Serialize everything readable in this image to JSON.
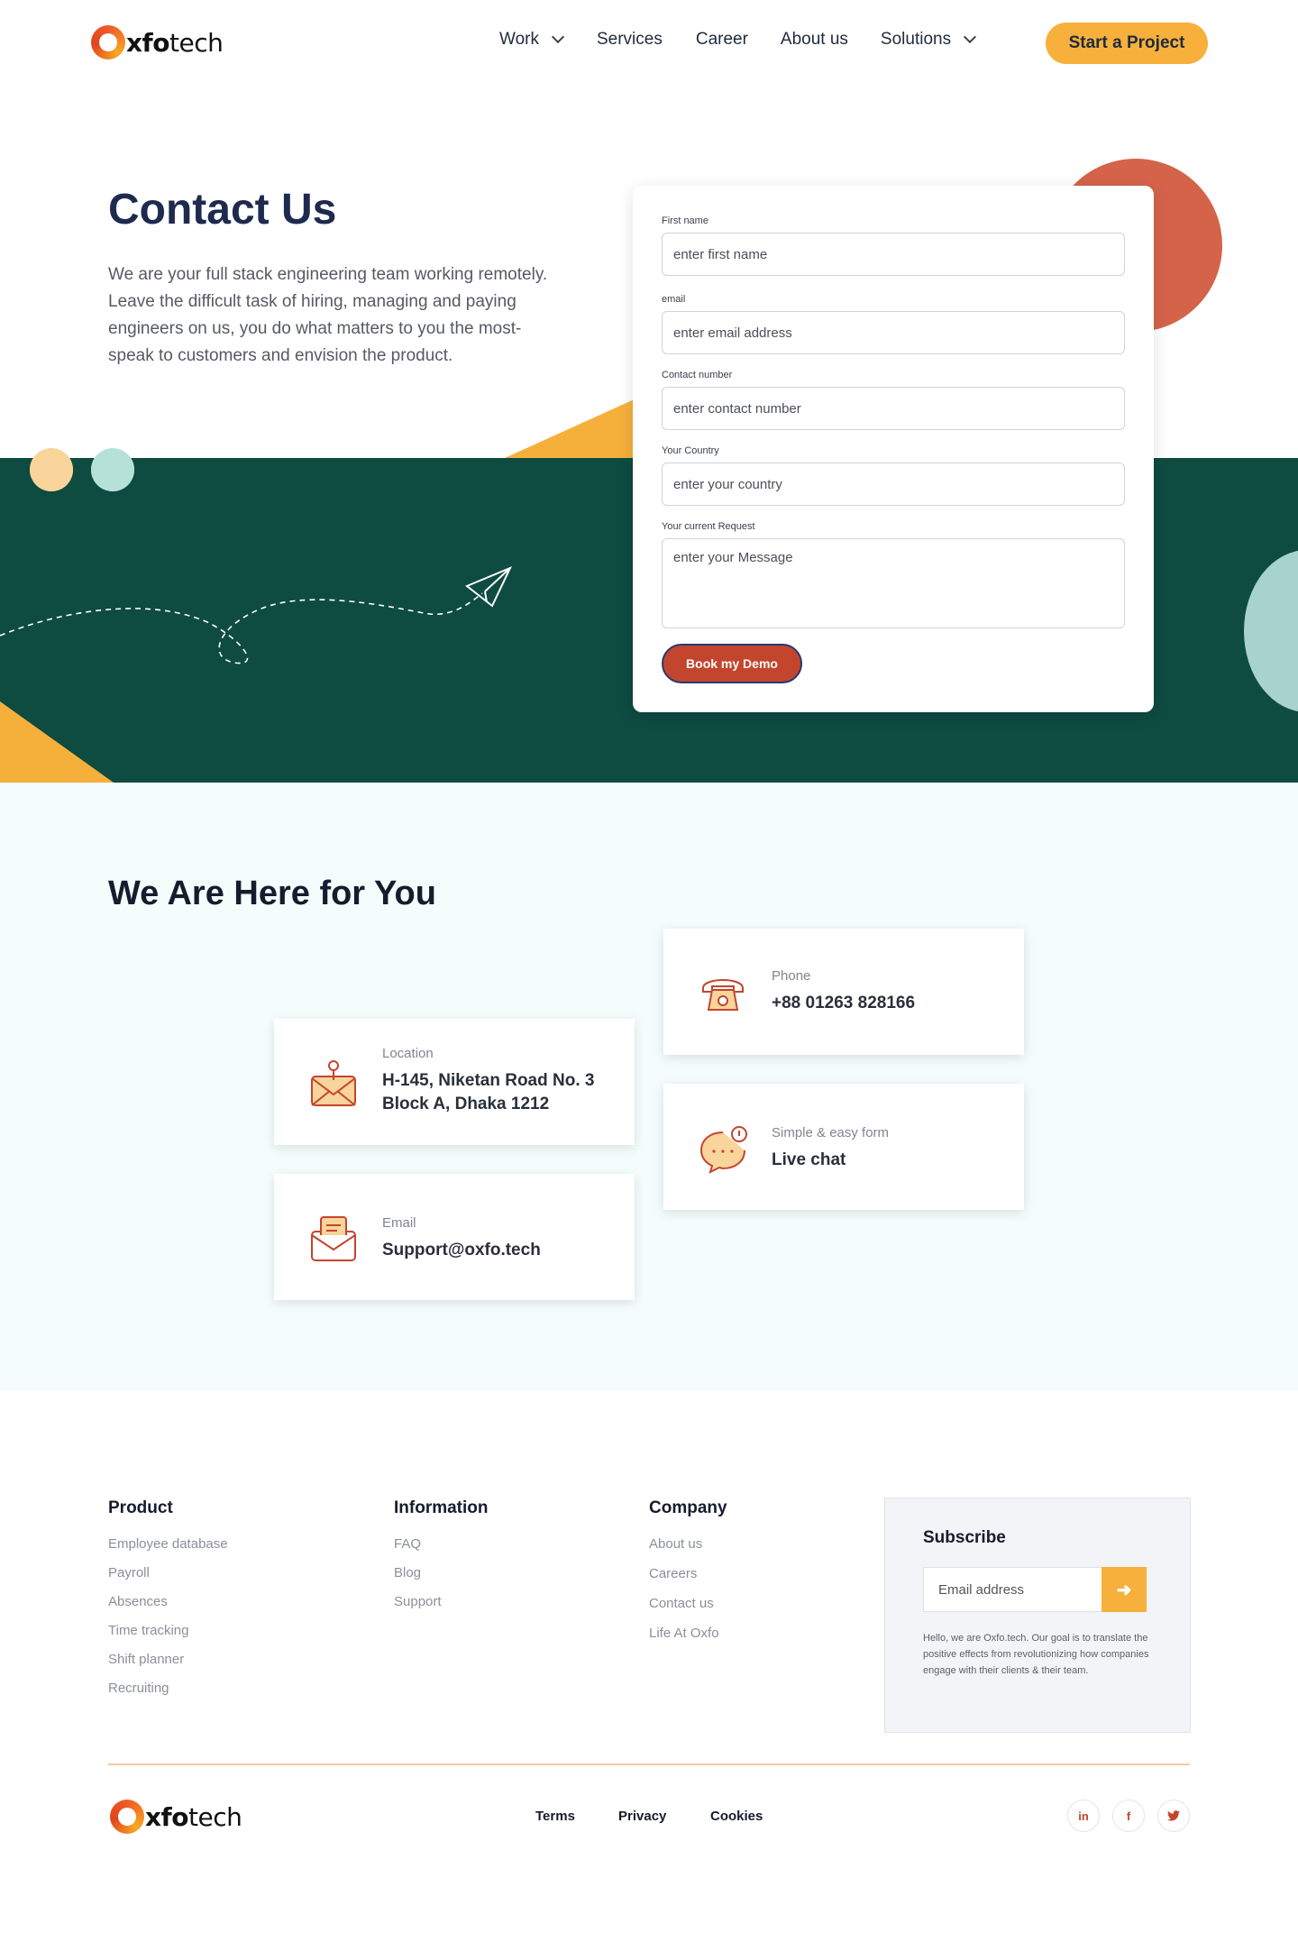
{
  "header": {
    "logo_text_bold": "xfo",
    "logo_text_rest": "tech",
    "nav": [
      {
        "label": "Work",
        "dropdown": true
      },
      {
        "label": "Services",
        "dropdown": false
      },
      {
        "label": "Career",
        "dropdown": false
      },
      {
        "label": "About us",
        "dropdown": false
      },
      {
        "label": "Solutions",
        "dropdown": true
      }
    ],
    "cta_label": "Start a  Project"
  },
  "hero": {
    "title": "Contact Us",
    "text": "We are your full stack engineering team working remotely. Leave the difficult task of hiring, managing and paying engineers on us, you do what matters to you the most- speak to customers and envision the product."
  },
  "form": {
    "fields": [
      {
        "label": "First name",
        "placeholder": "enter first name"
      },
      {
        "label": "email",
        "placeholder": "enter email address"
      },
      {
        "label": "Contact number",
        "placeholder": "enter contact number"
      },
      {
        "label": "Your Country",
        "placeholder": "enter your country"
      },
      {
        "label": "Your current Request",
        "placeholder": "enter your Message"
      }
    ],
    "submit_label": "Book my Demo"
  },
  "here": {
    "title": "We Are Here for You",
    "cards": {
      "phone": {
        "label": "Phone",
        "value": "+88 01263 828166",
        "icon": "telephone-icon"
      },
      "location": {
        "label": "Location",
        "value_line1": "H-145, Niketan Road No. 3",
        "value_line2": "Block A, Dhaka 1212",
        "icon": "location-mail-icon"
      },
      "chat": {
        "label": "Simple & easy form",
        "value": "Live chat",
        "icon": "chat-bubble-icon"
      },
      "email": {
        "label": "Email",
        "value": "Support@oxfo.tech",
        "icon": "envelope-icon"
      }
    }
  },
  "footer": {
    "product": {
      "title": "Product",
      "links": [
        "Employee database",
        "Payroll",
        "Absences",
        "Time tracking",
        "Shift planner",
        "Recruiting"
      ]
    },
    "information": {
      "title": "Information",
      "links": [
        "FAQ",
        "Blog",
        "Support"
      ]
    },
    "company": {
      "title": "Company",
      "links": [
        "About us",
        "Careers",
        "Contact us",
        "Life At Oxfo"
      ]
    },
    "subscribe": {
      "title": "Subscribe",
      "placeholder": "Email address",
      "note": "Hello, we are Oxfo.tech. Our goal is to translate the positive effects from revolutionizing how companies engage with their clients & their team."
    },
    "legal": [
      "Terms",
      "Privacy",
      "Cookies"
    ],
    "social": [
      {
        "icon": "linkedin-icon",
        "glyph": "in"
      },
      {
        "icon": "facebook-icon",
        "glyph": "f"
      },
      {
        "icon": "twitter-icon",
        "glyph": "t"
      }
    ]
  },
  "colors": {
    "accent_orange": "#f7b03c",
    "brand_green": "#0e4b41",
    "brand_red": "#c4452e",
    "coral": "#d4634a",
    "mint": "#a8d3cc"
  }
}
